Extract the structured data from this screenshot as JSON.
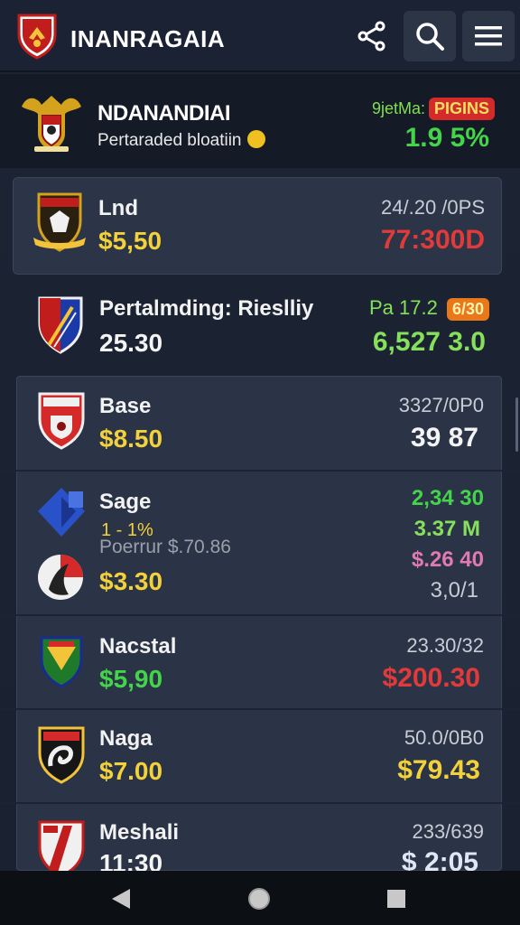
{
  "app": {
    "title": "INANRAGAIA"
  },
  "hero": {
    "name": "NDANANDIAI",
    "subtitle": "Pertaraded bloatiin",
    "tag_prefix": "9jetMa:",
    "tag_badge": "PIGINS",
    "percent": "1.9 5%"
  },
  "rows": [
    {
      "name": "Lnd",
      "price": "$5,50",
      "meta": "24/.20 /0PS",
      "value": "77:300D"
    },
    {
      "name": "Pertalmding: Rieslliy",
      "price": "25.30",
      "meta_prefix": "Pa 17.2",
      "meta_badge": "6/30",
      "value": "6,527 3.0"
    },
    {
      "name": "Base",
      "price": "$8.50",
      "meta": "3327/0P0",
      "value": "39 87"
    },
    {
      "name": "Sage",
      "subline_a": "1 - 1%",
      "subline_b": "Poerrur $.70.86",
      "price": "$3.30",
      "values": [
        "2,34 30",
        "3.37 M",
        "$.26 40",
        "3,0/1"
      ]
    },
    {
      "name": "Nacstal",
      "price": "$5,90",
      "meta": "23.30/32",
      "value": "$200.30"
    },
    {
      "name": "Naga",
      "price": "$7.00",
      "meta": "50.0/0B0",
      "value": "$79.43"
    },
    {
      "name": "Meshali",
      "price": "11:30",
      "meta": "233/639",
      "value": "$ 2:05"
    }
  ],
  "colors": {
    "background": "#1a2232",
    "accent_yellow": "#f3d13a",
    "accent_red": "#e03a3a",
    "accent_green": "#44d44a"
  },
  "icons": {
    "share": "share-icon",
    "search": "search-icon",
    "menu": "hamburger-menu-icon",
    "back": "back-triangle-icon",
    "home": "home-circle-icon",
    "recents": "recents-square-icon"
  }
}
